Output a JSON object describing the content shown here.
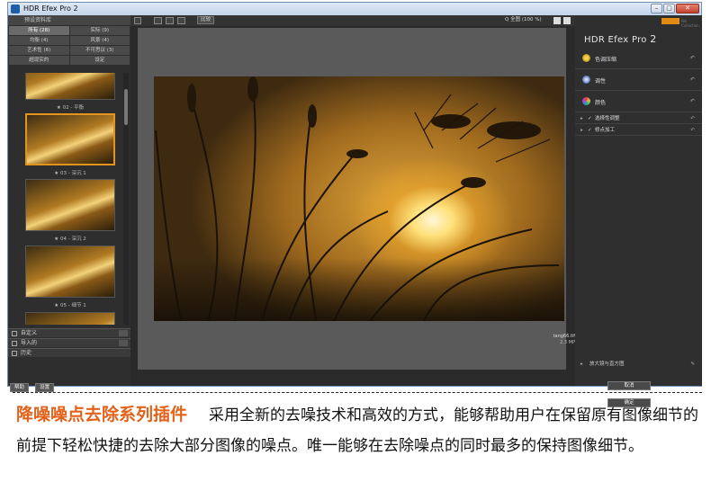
{
  "window": {
    "title": "HDR Efex Pro 2",
    "min": "–",
    "max": "▢",
    "close": "✕"
  },
  "left_panel": {
    "header": "预设资料库",
    "categories": [
      {
        "label": "所有 (28)",
        "selected": true
      },
      {
        "label": "实际 (9)",
        "selected": false
      },
      {
        "label": "均衡 (4)",
        "selected": false
      },
      {
        "label": "风景 (4)",
        "selected": false
      },
      {
        "label": "艺术性 (6)",
        "selected": false
      },
      {
        "label": "不可思议 (3)",
        "selected": false
      },
      {
        "label": "超现实的",
        "selected": false
      },
      {
        "label": "设定",
        "selected": false
      }
    ],
    "thumbnails": [
      {
        "caption": "★ 02 - 平衡"
      },
      {
        "caption": "★ 03 - 深沉 1"
      },
      {
        "caption": "★ 04 - 深沉 2"
      },
      {
        "caption": "★ 05 - 细节 1"
      }
    ],
    "sections": [
      "自定义",
      "导入的",
      "历史"
    ],
    "buttons": [
      "帮助",
      "设置"
    ]
  },
  "toolbar": {
    "compare": "比较",
    "zoom": "Q 全图 (100 %)"
  },
  "image": {
    "filename": "tang66.tif",
    "size": "2.3 MP"
  },
  "right_panel": {
    "brand_small": "Nik Collection",
    "title": "HDR Efex Pro",
    "version": "2",
    "rows": [
      {
        "label": "色调压缩",
        "icon": "tone-compression-icon",
        "color": "#e0b030"
      },
      {
        "label": "调性",
        "icon": "tonality-icon",
        "color": "#4a7fd0"
      },
      {
        "label": "颜色",
        "icon": "color-icon",
        "color": "#d04a8a"
      }
    ],
    "subrows": [
      {
        "label": "选择性调整"
      },
      {
        "label": "修点加工"
      }
    ],
    "loupe": "放大镜与直方图",
    "undo": "↶",
    "buttons": [
      "取消",
      "确定"
    ]
  },
  "caption": {
    "heading": "降噪噪点去除系列插件",
    "text": "采用全新的去噪技术和高效的方式，能够帮助用户在保留原有图像细节的前提下轻松快捷的去除大部分图像的噪点。唯一能够在去除噪点的同时最多的保持图像细节。"
  }
}
